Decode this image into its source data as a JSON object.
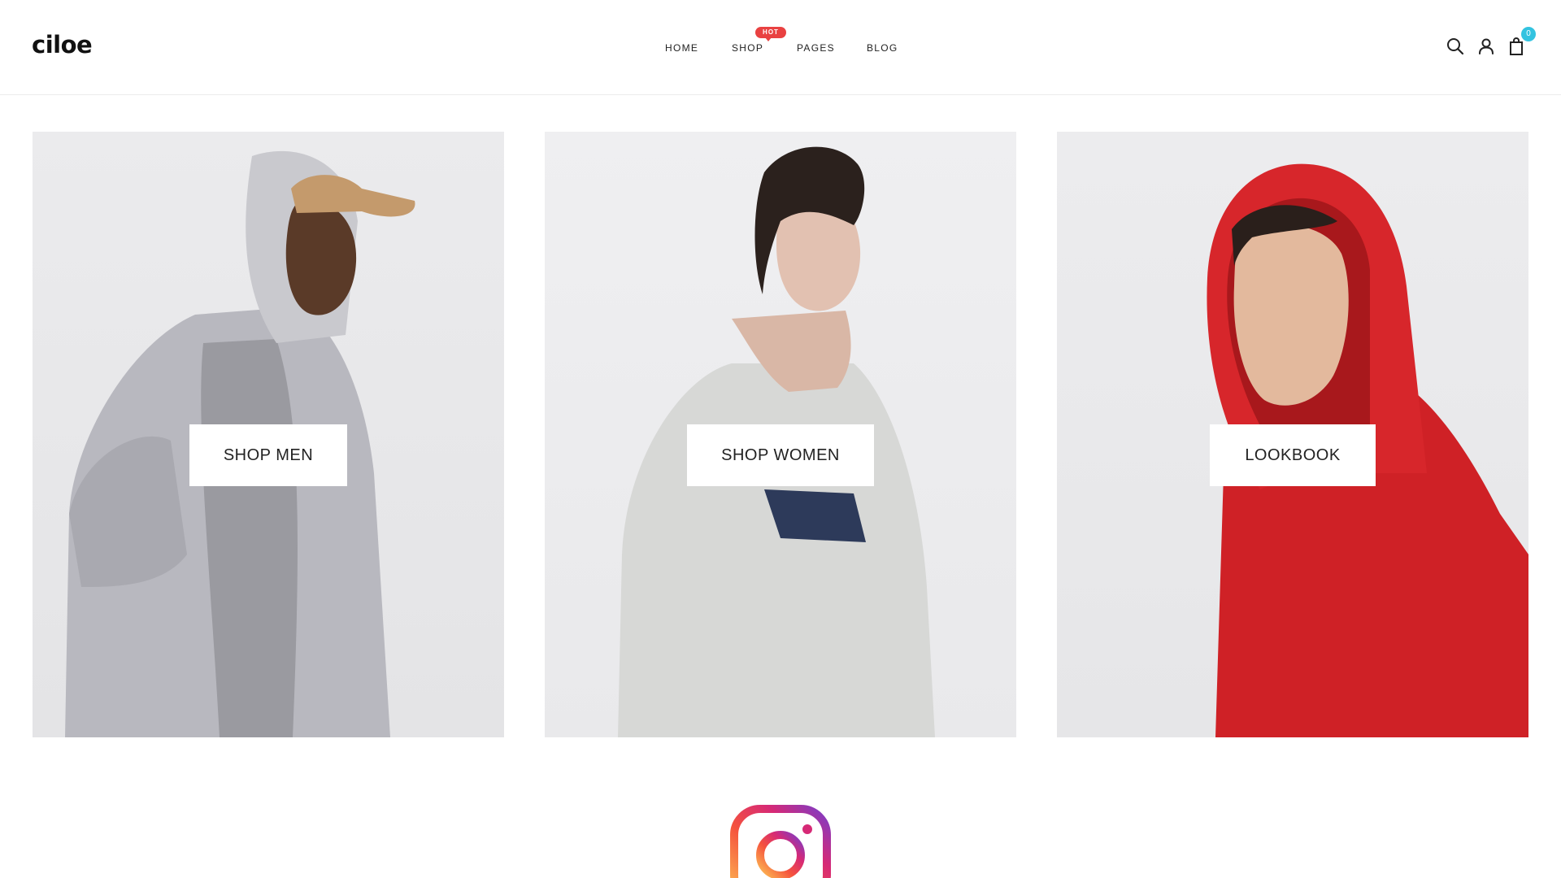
{
  "brand": {
    "logo_text": "ciloe"
  },
  "nav": {
    "items": [
      {
        "label": "HOME"
      },
      {
        "label": "SHOP",
        "badge": "HOT"
      },
      {
        "label": "PAGES"
      },
      {
        "label": "BLOG"
      }
    ]
  },
  "header_icons": {
    "search": "search-icon",
    "account": "user-icon",
    "cart": "shopping-bag-icon",
    "cart_count": "0"
  },
  "banners": [
    {
      "label": "SHOP MEN",
      "image": "man-in-grey-hooded-jacket-and-tan-cap"
    },
    {
      "label": "SHOP WOMEN",
      "image": "woman-in-light-grey-cardigan"
    },
    {
      "label": "LOOKBOOK",
      "image": "man-in-red-hoodie"
    }
  ],
  "footer": {
    "icon": "instagram-icon"
  },
  "colors": {
    "badge_hot": "#e94141",
    "cart_badge": "#33c3e0",
    "text": "#222222",
    "divider": "#ececec"
  }
}
